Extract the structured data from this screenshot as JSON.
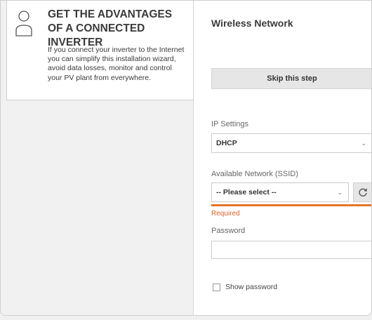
{
  "info_card": {
    "title": "GET THE ADVANTAGES OF A CONNECTED INVERTER",
    "body": "If you connect your inverter to the Internet you can simplify this installation wizard, avoid data losses, monitor and control your PV plant from everywhere.",
    "icon": "user-icon"
  },
  "form": {
    "title": "Wireless Network",
    "skip_label": "Skip this step",
    "ip_settings": {
      "label": "IP Settings",
      "value": "DHCP"
    },
    "network": {
      "label": "Available Network (SSID)",
      "value": "-- Please select --",
      "error": "Required",
      "refresh_icon": "refresh-icon"
    },
    "password": {
      "label": "Password",
      "value": ""
    },
    "show_password": {
      "label": "Show password",
      "checked": false
    }
  },
  "colors": {
    "accent": "#e8742c",
    "error": "#e0622a"
  }
}
